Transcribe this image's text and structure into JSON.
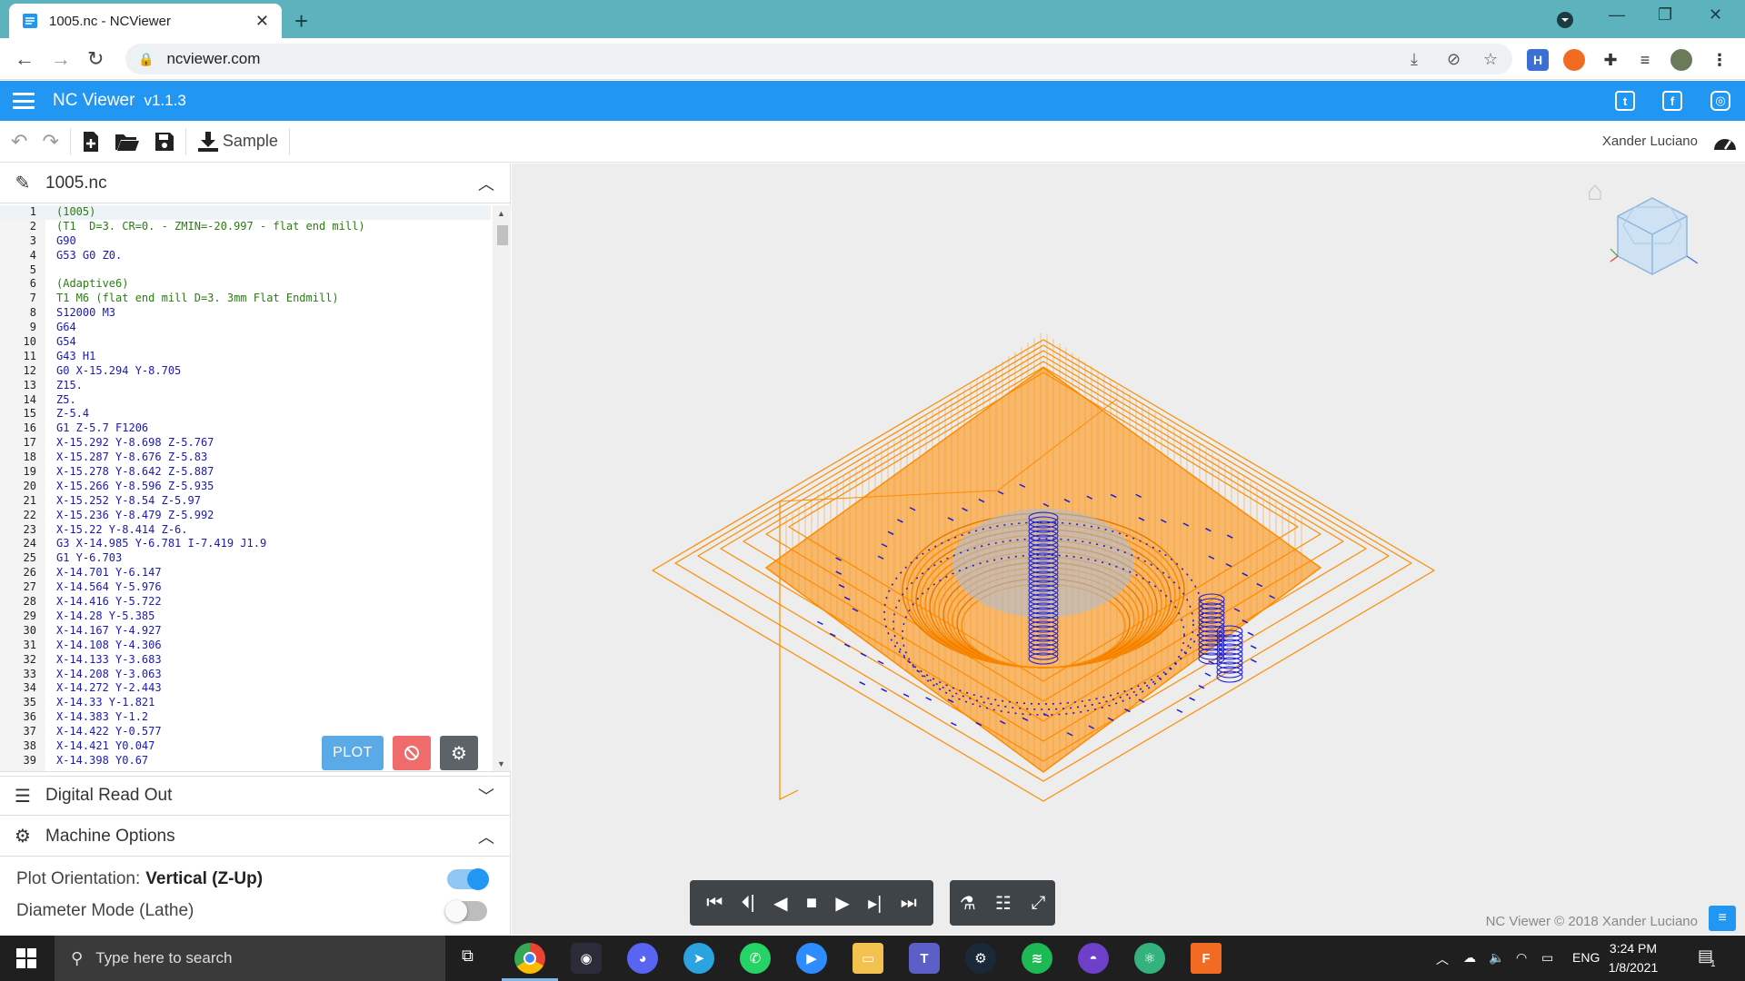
{
  "browser": {
    "tab_title": "1005.nc - NCViewer",
    "url": "ncviewer.com",
    "extension_h": "H"
  },
  "app": {
    "title": "NC Viewer",
    "version": "v1.1.3",
    "user": "Xander Luciano",
    "sample_label": "Sample"
  },
  "file_panel": {
    "filename": "1005.nc"
  },
  "code": [
    {
      "n": "1",
      "t": "(1005)",
      "k": "comment"
    },
    {
      "n": "2",
      "t": "(T1  D=3. CR=0. - ZMIN=-20.997 - flat end mill)",
      "k": "comment"
    },
    {
      "n": "3",
      "t": "G90",
      "k": "code"
    },
    {
      "n": "4",
      "t": "G53 G0 Z0.",
      "k": "code"
    },
    {
      "n": "5",
      "t": "",
      "k": "code"
    },
    {
      "n": "6",
      "t": "(Adaptive6)",
      "k": "comment"
    },
    {
      "n": "7",
      "t": "T1 M6 (flat end mill D=3. 3mm Flat Endmill)",
      "k": "comment"
    },
    {
      "n": "8",
      "t": "S12000 M3",
      "k": "code"
    },
    {
      "n": "9",
      "t": "G64",
      "k": "code"
    },
    {
      "n": "10",
      "t": "G54",
      "k": "code"
    },
    {
      "n": "11",
      "t": "G43 H1",
      "k": "code"
    },
    {
      "n": "12",
      "t": "G0 X-15.294 Y-8.705",
      "k": "code"
    },
    {
      "n": "13",
      "t": "Z15.",
      "k": "code"
    },
    {
      "n": "14",
      "t": "Z5.",
      "k": "code"
    },
    {
      "n": "15",
      "t": "Z-5.4",
      "k": "code"
    },
    {
      "n": "16",
      "t": "G1 Z-5.7 F1206",
      "k": "code"
    },
    {
      "n": "17",
      "t": "X-15.292 Y-8.698 Z-5.767",
      "k": "code"
    },
    {
      "n": "18",
      "t": "X-15.287 Y-8.676 Z-5.83",
      "k": "code"
    },
    {
      "n": "19",
      "t": "X-15.278 Y-8.642 Z-5.887",
      "k": "code"
    },
    {
      "n": "20",
      "t": "X-15.266 Y-8.596 Z-5.935",
      "k": "code"
    },
    {
      "n": "21",
      "t": "X-15.252 Y-8.54 Z-5.97",
      "k": "code"
    },
    {
      "n": "22",
      "t": "X-15.236 Y-8.479 Z-5.992",
      "k": "code"
    },
    {
      "n": "23",
      "t": "X-15.22 Y-8.414 Z-6.",
      "k": "code"
    },
    {
      "n": "24",
      "t": "G3 X-14.985 Y-6.781 I-7.419 J1.9",
      "k": "code"
    },
    {
      "n": "25",
      "t": "G1 Y-6.703",
      "k": "code"
    },
    {
      "n": "26",
      "t": "X-14.701 Y-6.147",
      "k": "code"
    },
    {
      "n": "27",
      "t": "X-14.564 Y-5.976",
      "k": "code"
    },
    {
      "n": "28",
      "t": "X-14.416 Y-5.722",
      "k": "code"
    },
    {
      "n": "29",
      "t": "X-14.28 Y-5.385",
      "k": "code"
    },
    {
      "n": "30",
      "t": "X-14.167 Y-4.927",
      "k": "code"
    },
    {
      "n": "31",
      "t": "X-14.108 Y-4.306",
      "k": "code"
    },
    {
      "n": "32",
      "t": "X-14.133 Y-3.683",
      "k": "code"
    },
    {
      "n": "33",
      "t": "X-14.208 Y-3.063",
      "k": "code"
    },
    {
      "n": "34",
      "t": "X-14.272 Y-2.443",
      "k": "code"
    },
    {
      "n": "35",
      "t": "X-14.33 Y-1.821",
      "k": "code"
    },
    {
      "n": "36",
      "t": "X-14.383 Y-1.2",
      "k": "code"
    },
    {
      "n": "37",
      "t": "X-14.422 Y-0.577",
      "k": "code"
    },
    {
      "n": "38",
      "t": "X-14.421 Y0.047",
      "k": "code"
    },
    {
      "n": "39",
      "t": "X-14.398 Y0.67",
      "k": "code"
    }
  ],
  "buttons": {
    "plot": "PLOT"
  },
  "sections": {
    "dro": "Digital Read Out",
    "machine_options": "Machine Options"
  },
  "machine_options": {
    "plot_orientation_label": "Plot Orientation:",
    "plot_orientation_value": "Vertical (Z-Up)",
    "plot_orientation_on": true,
    "diameter_mode_label": "Diameter Mode (Lathe)",
    "diameter_mode_on": false
  },
  "viewer": {
    "copyright": "NC Viewer © 2018 Xander Luciano"
  },
  "colors": {
    "toolpath": "#ff8c00",
    "rapid": "#1a1ad8",
    "accent": "#2196f3"
  },
  "taskbar": {
    "search_placeholder": "Type here to search",
    "language": "ENG",
    "time": "3:24 PM",
    "date": "1/8/2021",
    "notification_count": "1"
  }
}
